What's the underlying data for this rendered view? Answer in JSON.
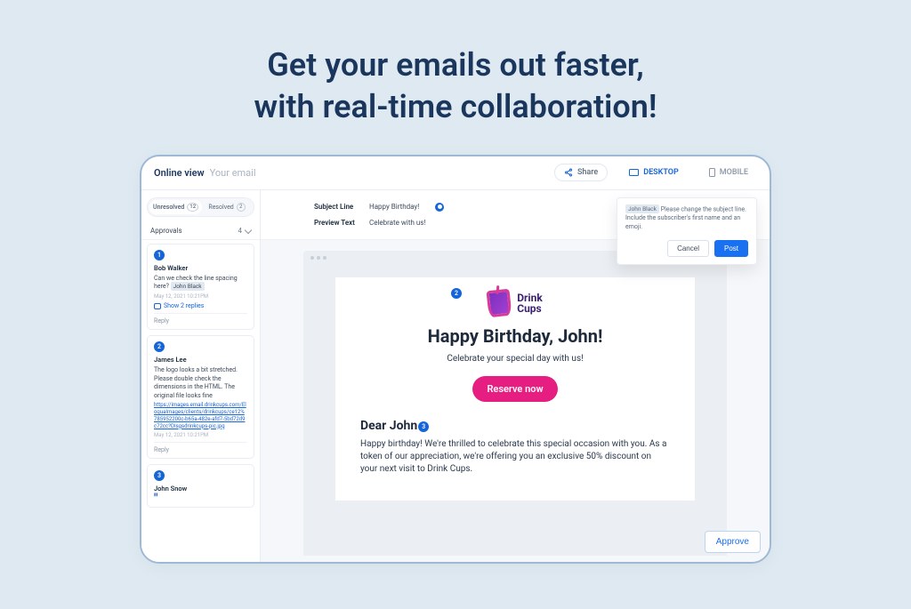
{
  "hero": {
    "line1": "Get your emails out faster,",
    "line2": "with real-time collaboration!"
  },
  "topbar": {
    "view_mode": "Online view",
    "placeholder": "Your email",
    "share_label": "Share",
    "desktop_label": "DESKTOP",
    "mobile_label": "MOBILE"
  },
  "sidebar": {
    "tab_unresolved": "Unresolved",
    "tab_unresolved_count": "12",
    "tab_resolved": "Resolved",
    "tab_resolved_count": "2",
    "approvals_label": "Approvals",
    "approvals_count": "4",
    "reply_label": "Reply",
    "show_replies": "Show 2 replies",
    "comments": [
      {
        "num": "1",
        "author": "Bob Walker",
        "body_pre": "Can we check the line spacing here? ",
        "mention": "John Black",
        "timestamp": "May 12, 2021 10:21PM"
      },
      {
        "num": "2",
        "author": "James Lee",
        "body": "The logo looks a bit stretched. Please double check the dimensions in the HTML. The original file looks fine",
        "url": "https://images.email.drinkcups.com/EloquaImages/clients/drinkcups/ce12%785952200c-b65a-482e-afd7-5bd72d9c72cc?DIsgsdrinkcups-pic.jpg",
        "timestamp": "May 12, 2021 10:21PM"
      },
      {
        "num": "3",
        "author": "John Snow"
      }
    ]
  },
  "meta": {
    "subject_label": "Subject Line",
    "subject_value": "Happy Birthday!",
    "preview_label": "Preview Text",
    "preview_value": "Celebrate with us!"
  },
  "popover": {
    "mention": "John Black",
    "text": "Please change the subject line. Include the subscriber's first name and an emoji.",
    "cancel": "Cancel",
    "post": "Post"
  },
  "preview": {
    "brand_line1": "Drink",
    "brand_line2": "Cups",
    "heading": "Happy Birthday, John!",
    "subheading": "Celebrate your special day with us!",
    "cta": "Reserve now",
    "greeting_pre": "Dear John",
    "greeting_suf": ",",
    "bubble2": "2",
    "bubble3": "3",
    "body": "Happy birthday! We're thrilled to celebrate this special occasion with you. As a token of our appreciation, we're offering you an exclusive 50% discount on your next visit to Drink Cups."
  },
  "approve_label": "Approve"
}
